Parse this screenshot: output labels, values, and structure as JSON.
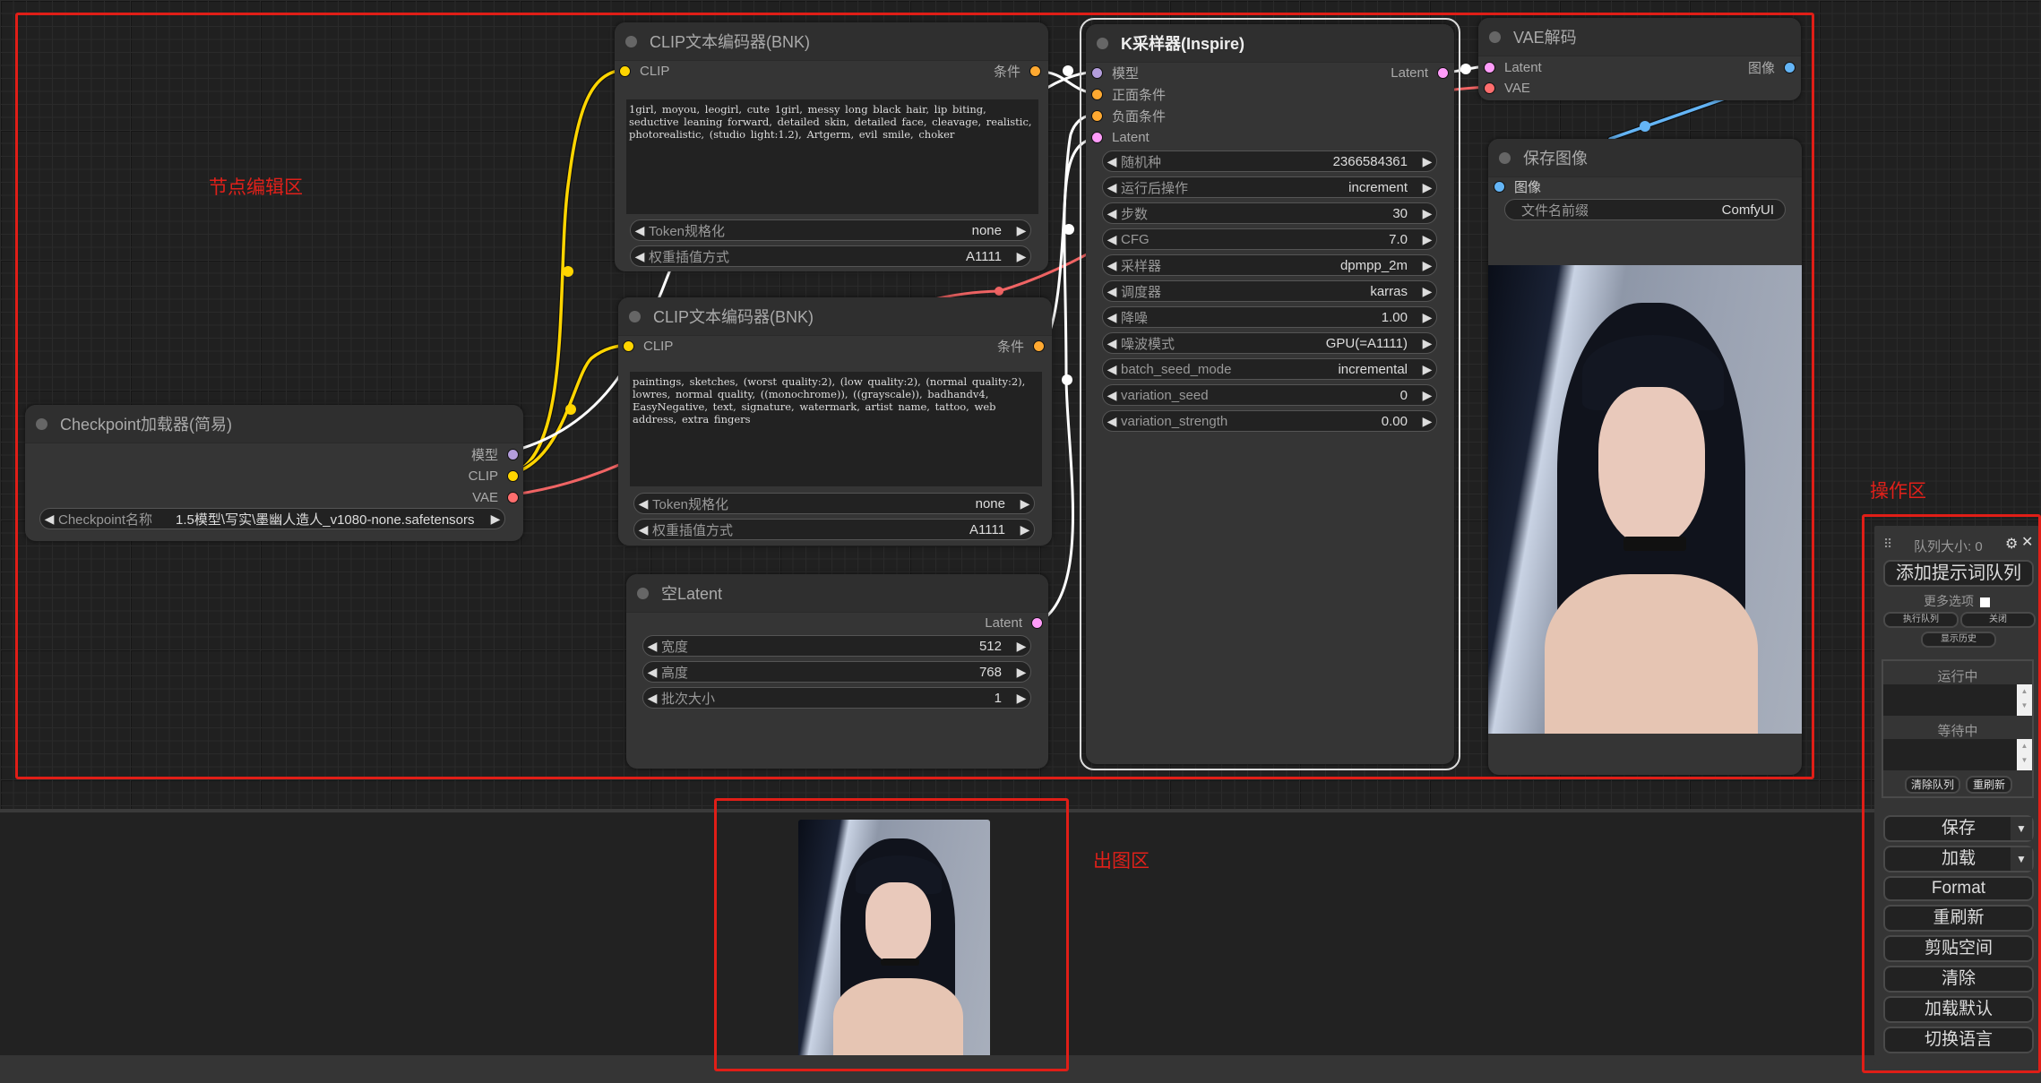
{
  "annotations": {
    "node_editor": "节点编辑区",
    "output_area": "出图区",
    "operation_area": "操作区"
  },
  "nodes": {
    "clip_positive": {
      "title": "CLIP文本编码器(BNK)",
      "input": "CLIP",
      "output": "条件",
      "text": "1girl, moyou, leogirl, cute 1girl, messy long black hair, lip biting, seductive leaning forward, detailed skin, detailed face, cleavage, realistic, photorealistic, (studio light:1.2), Artgerm, evil smile, choker",
      "widgets": [
        {
          "label": "Token规格化",
          "value": "none"
        },
        {
          "label": "权重插值方式",
          "value": "A1111"
        }
      ]
    },
    "clip_negative": {
      "title": "CLIP文本编码器(BNK)",
      "input": "CLIP",
      "output": "条件",
      "text": "paintings, sketches, (worst quality:2), (low quality:2), (normal quality:2), lowres, normal quality, ((monochrome)), ((grayscale)), badhandv4, EasyNegative, text, signature, watermark, artist name, tattoo, web address, extra fingers",
      "widgets": [
        {
          "label": "Token规格化",
          "value": "none"
        },
        {
          "label": "权重插值方式",
          "value": "A1111"
        }
      ]
    },
    "checkpoint": {
      "title": "Checkpoint加载器(简易)",
      "outputs": [
        "模型",
        "CLIP",
        "VAE"
      ],
      "widgets": [
        {
          "label": "Checkpoint名称",
          "value": "1.5模型\\写实\\墨幽人造人_v1080-none.safetensors"
        }
      ]
    },
    "ksampler": {
      "title": "K采样器(Inspire)",
      "inputs": [
        "模型",
        "正面条件",
        "负面条件",
        "Latent"
      ],
      "output": "Latent",
      "widgets": [
        {
          "label": "随机种",
          "value": "2366584361"
        },
        {
          "label": "运行后操作",
          "value": "increment"
        },
        {
          "label": "步数",
          "value": "30"
        },
        {
          "label": "CFG",
          "value": "7.0"
        },
        {
          "label": "采样器",
          "value": "dpmpp_2m"
        },
        {
          "label": "调度器",
          "value": "karras"
        },
        {
          "label": "降噪",
          "value": "1.00"
        },
        {
          "label": "噪波模式",
          "value": "GPU(=A1111)"
        },
        {
          "label": "batch_seed_mode",
          "value": "incremental"
        },
        {
          "label": "variation_seed",
          "value": "0"
        },
        {
          "label": "variation_strength",
          "value": "0.00"
        }
      ]
    },
    "vae_decode": {
      "title": "VAE解码",
      "inputs": [
        "Latent",
        "VAE"
      ],
      "output": "图像"
    },
    "save_image": {
      "title": "保存图像",
      "input": "图像",
      "widgets": [
        {
          "label": "文件名前缀",
          "value": "ComfyUI"
        }
      ]
    },
    "empty_latent": {
      "title": "空Latent",
      "output": "Latent",
      "widgets": [
        {
          "label": "宽度",
          "value": "512"
        },
        {
          "label": "高度",
          "value": "768"
        },
        {
          "label": "批次大小",
          "value": "1"
        }
      ]
    }
  },
  "colors": {
    "clip": "#ffd500",
    "conditioning": "#ffa931",
    "model": "#b39ddb",
    "latent": "#ff9cf9",
    "vae": "#ff6e6e",
    "image": "#64b5f6",
    "annotation": "#e0201a"
  },
  "queue": {
    "title": "队列大小: 0",
    "queue_prompt": "添加提示词队列",
    "extra_options": "更多选项",
    "queue_front": "执行队列",
    "close": "关闭",
    "view_history": "显示历史",
    "running": "运行中",
    "pending": "等待中",
    "clear_queue": "清除队列",
    "refresh_queue": "重刷新",
    "buttons": {
      "save": "保存",
      "load": "加载",
      "format": "Format",
      "refresh": "重刷新",
      "clipspace": "剪贴空间",
      "clear": "清除",
      "load_default": "加载默认",
      "switch_locale": "切换语言"
    }
  }
}
